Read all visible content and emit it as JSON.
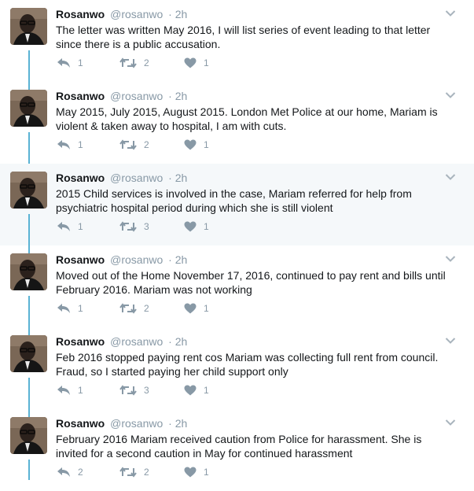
{
  "tweets": [
    {
      "name": "Rosanwo",
      "handle": "@rosanwo",
      "time": "· 2h",
      "text": "The letter was written May 2016, I will list series of event leading to that letter since there is a public accusation.",
      "replies": "1",
      "retweets": "2",
      "likes": "1",
      "highlighted": false
    },
    {
      "name": "Rosanwo",
      "handle": "@rosanwo",
      "time": "· 2h",
      "text": "May 2015, July 2015, August 2015. London Met Police at our home, Mariam is violent & taken away to hospital, I am with cuts.",
      "replies": "1",
      "retweets": "2",
      "likes": "1",
      "highlighted": false
    },
    {
      "name": "Rosanwo",
      "handle": "@rosanwo",
      "time": "· 2h",
      "text": "2015 Child services is involved in the case, Mariam referred for help from psychiatric hospital period during which she is still violent",
      "replies": "1",
      "retweets": "3",
      "likes": "1",
      "highlighted": true
    },
    {
      "name": "Rosanwo",
      "handle": "@rosanwo",
      "time": "· 2h",
      "text": "Moved out of the Home November 17, 2016, continued to pay rent and bills until February 2016. Mariam was not working",
      "replies": "1",
      "retweets": "2",
      "likes": "1",
      "highlighted": false
    },
    {
      "name": "Rosanwo",
      "handle": "@rosanwo",
      "time": "· 2h",
      "text": "Feb 2016 stopped paying rent cos Mariam was collecting full rent from council. Fraud, so I started paying her child support only",
      "replies": "1",
      "retweets": "3",
      "likes": "1",
      "highlighted": false
    },
    {
      "name": "Rosanwo",
      "handle": "@rosanwo",
      "time": "· 2h",
      "text": "February 2016 Mariam received caution from Police for harassment. She is invited for a second caution in May for continued harassment",
      "replies": "2",
      "retweets": "2",
      "likes": "1",
      "highlighted": false
    }
  ],
  "icons": {
    "reply": "reply-icon",
    "retweet": "retweet-icon",
    "like": "heart-icon",
    "menu": "chevron-down-icon"
  },
  "colors": {
    "thread_line": "#5ab3d4",
    "muted": "#8899a6",
    "highlight_bg": "#f5f8fa"
  }
}
